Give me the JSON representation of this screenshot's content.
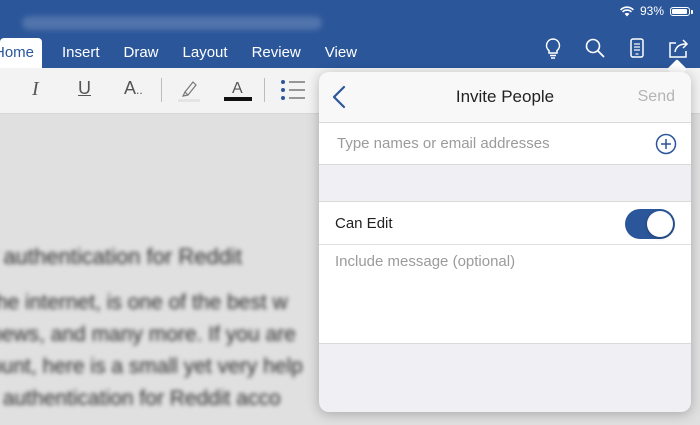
{
  "status_bar": {
    "battery_text": "93%"
  },
  "ribbon": {
    "tabs": [
      {
        "label": "Home",
        "active": true
      },
      {
        "label": "Insert",
        "active": false
      },
      {
        "label": "Draw",
        "active": false
      },
      {
        "label": "Layout",
        "active": false
      },
      {
        "label": "Review",
        "active": false
      },
      {
        "label": "View",
        "active": false
      }
    ],
    "right_icons": [
      "lightbulb-icon",
      "search-icon",
      "mobile-view-icon",
      "share-icon"
    ]
  },
  "toolbar": {
    "italic_label": "I",
    "underline_label": "U",
    "font_size_label": "A"
  },
  "document": {
    "lines": [
      "r authentication for Reddit",
      "the internet, is one of the best w",
      "news, and many more. If you are",
      "ount, here is a small yet very help",
      "r authentication for Reddit acco"
    ]
  },
  "popover": {
    "title": "Invite People",
    "send_label": "Send",
    "recipient_placeholder": "Type names or email addresses",
    "permission_label": "Can Edit",
    "permission_enabled": true,
    "message_placeholder": "Include message (optional)"
  },
  "colors": {
    "brand_blue": "#2b569a",
    "toggle_on": "#2b569a"
  }
}
